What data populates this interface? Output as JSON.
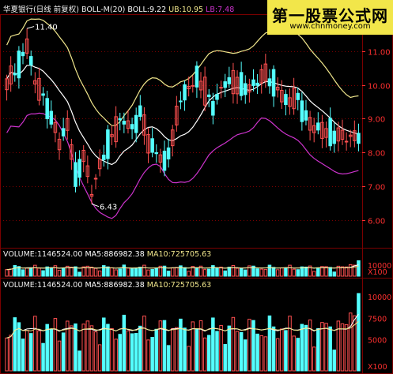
{
  "watermark": {
    "title": "第一股票公式网",
    "url": "www.chnmoney.com"
  },
  "main_header": {
    "stock": "华夏银行(日线 前复权)",
    "boll": "BOLL-M(20)",
    "boll_val": "BOLL:9.22",
    "ub": "UB:10.95",
    "lb": "LB:7.48"
  },
  "vol_header_1": {
    "vol": "VOLUME:1146524.00",
    "ma5": "MA5:886982.38",
    "ma10": "MA10:725705.63"
  },
  "vol_header_2": {
    "vol": "VOLUME:1146524.00",
    "ma5": "MA5:886982.38",
    "ma10": "MA10:725705.63"
  },
  "colors": {
    "up": "#ff5050",
    "down": "#54ffff",
    "boll": "#ffffff",
    "ub": "#f0e68c",
    "lb": "#cc33cc",
    "grid": "#7a0000",
    "axis_text": "#ff3030",
    "ma5": "#ffffff",
    "ma10": "#f0e68c"
  },
  "chart_data": [
    {
      "type": "candlestick",
      "title": "华夏银行(日线 前复权)",
      "indicator": "BOLL-M(20)",
      "ylim": [
        5.5,
        12.0
      ],
      "y_ticks": [
        "6.00",
        "7.00",
        "8.00",
        "9.00",
        "10.00",
        "11.00"
      ],
      "annotations": [
        {
          "label": "11.40"
        },
        {
          "label": "6.43"
        }
      ],
      "series": [
        {
          "name": "BOLL",
          "value": 9.22
        },
        {
          "name": "UB",
          "value": 10.95
        },
        {
          "name": "LB",
          "value": 7.48
        }
      ],
      "grid": true
    },
    {
      "type": "bar",
      "title": "VOLUME",
      "y_ticks": [
        "10000",
        "X100"
      ],
      "series": [
        {
          "name": "VOLUME",
          "value": 1146524.0
        },
        {
          "name": "MA5",
          "value": 886982.38
        },
        {
          "name": "MA10",
          "value": 725705.63
        }
      ]
    },
    {
      "type": "bar",
      "title": "VOLUME",
      "y_ticks": [
        "10000",
        "7500",
        "5000",
        "X100"
      ],
      "series": [
        {
          "name": "VOLUME",
          "value": 1146524.0
        },
        {
          "name": "MA5",
          "value": 886982.38
        },
        {
          "name": "MA10",
          "value": 725705.63
        }
      ]
    }
  ]
}
